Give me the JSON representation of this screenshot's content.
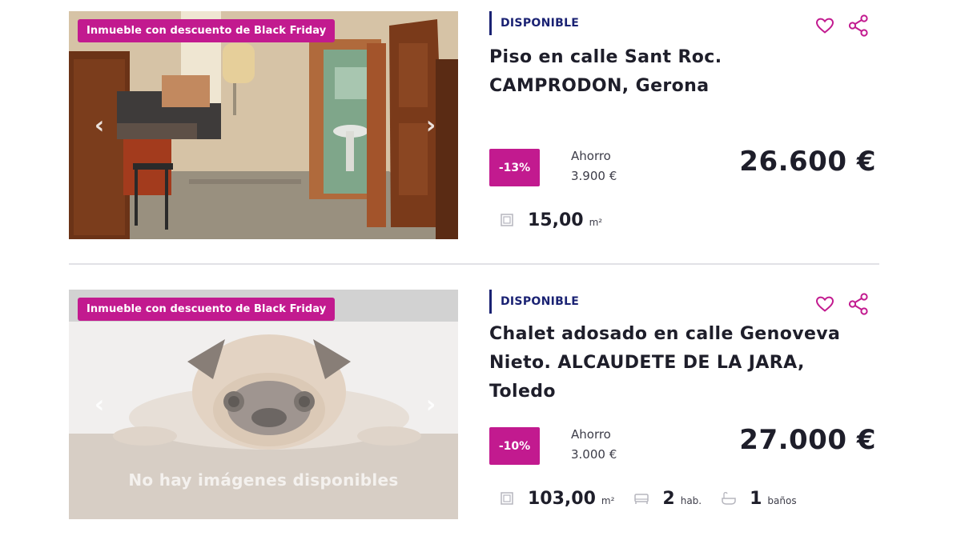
{
  "colors": {
    "accent": "#c21a8f",
    "status": "#1a2273",
    "divider": "#e1e1e6"
  },
  "listings": [
    {
      "badge": "Inmueble con descuento de Black Friday",
      "status": "DISPONIBLE",
      "title": "Piso en calle Sant Roc. CAMPRODON, Gerona",
      "discount": "-13%",
      "savings_label": "Ahorro",
      "savings_value": "3.900 €",
      "price": "26.600 €",
      "area": "15,00",
      "area_unit": "m²",
      "icons": [
        "heart-icon",
        "share-icon",
        "chevron-left-icon",
        "chevron-right-icon",
        "area-icon"
      ]
    },
    {
      "badge": "Inmueble con descuento de Black Friday",
      "status": "DISPONIBLE",
      "title": "Chalet adosado en calle Genoveva Nieto. ALCAUDETE DE LA JARA, Toledo",
      "no_images": "No hay imágenes disponibles",
      "discount": "-10%",
      "savings_label": "Ahorro",
      "savings_value": "3.000 €",
      "price": "27.000 €",
      "area": "103,00",
      "area_unit": "m²",
      "rooms": "2",
      "rooms_unit": "hab.",
      "baths": "1",
      "baths_unit": "baños",
      "icons": [
        "heart-icon",
        "share-icon",
        "chevron-left-icon",
        "chevron-right-icon",
        "area-icon",
        "bed-icon",
        "bath-icon"
      ]
    }
  ]
}
